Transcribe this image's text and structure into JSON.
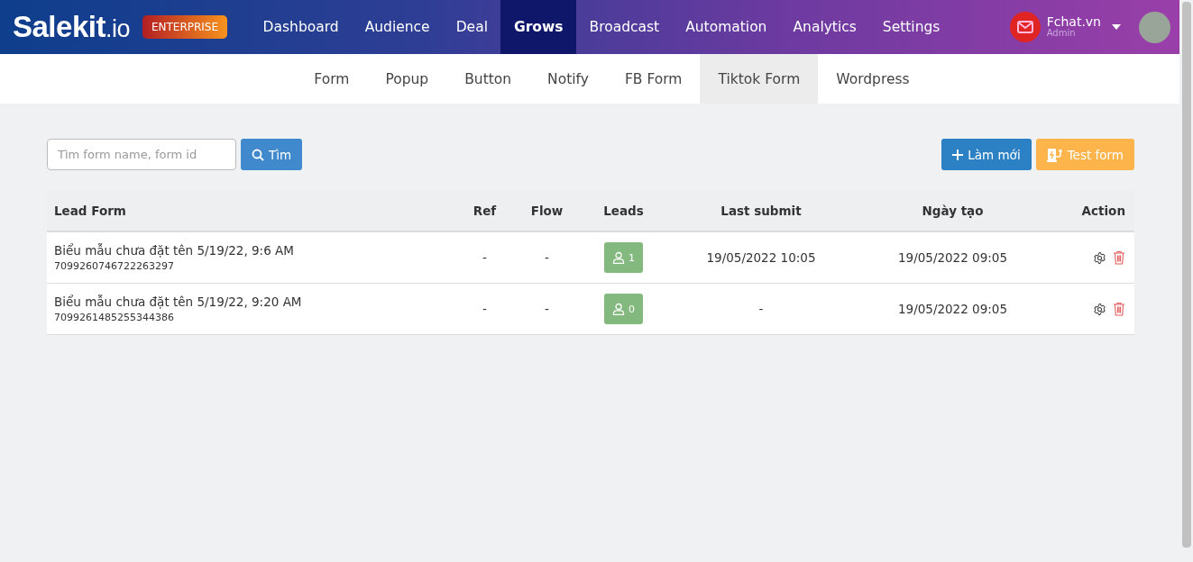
{
  "brand": {
    "name": "Salekit",
    "suffix": ".io",
    "badge": "ENTERPRISE"
  },
  "nav": [
    {
      "label": "Dashboard",
      "selected": false
    },
    {
      "label": "Audience",
      "selected": false
    },
    {
      "label": "Deal",
      "selected": false
    },
    {
      "label": "Grows",
      "selected": true
    },
    {
      "label": "Broadcast",
      "selected": false
    },
    {
      "label": "Automation",
      "selected": false
    },
    {
      "label": "Analytics",
      "selected": false
    },
    {
      "label": "Settings",
      "selected": false
    }
  ],
  "account": {
    "name": "Fchat.vn",
    "role": "Admin"
  },
  "subtabs": [
    {
      "label": "Form",
      "selected": false
    },
    {
      "label": "Popup",
      "selected": false
    },
    {
      "label": "Button",
      "selected": false
    },
    {
      "label": "Notify",
      "selected": false
    },
    {
      "label": "FB Form",
      "selected": false
    },
    {
      "label": "Tiktok Form",
      "selected": true
    },
    {
      "label": "Wordpress",
      "selected": false
    }
  ],
  "search": {
    "placeholder": "Tìm form name, form id",
    "button": "Tìm"
  },
  "actions": {
    "new": "Làm mới",
    "test": "Test form"
  },
  "table": {
    "columns": [
      "Lead Form",
      "Ref",
      "Flow",
      "Leads",
      "Last submit",
      "Ngày tạo",
      "Action"
    ],
    "rows": [
      {
        "name": "Biểu mẫu chưa đặt tên 5/19/22, 9:6 AM",
        "id": "7099260746722263297",
        "ref": "-",
        "flow": "-",
        "leads": "1",
        "last_submit": "19/05/2022 10:05",
        "created": "19/05/2022 09:05"
      },
      {
        "name": "Biểu mẫu chưa đặt tên 5/19/22, 9:20 AM",
        "id": "7099261485255344386",
        "ref": "-",
        "flow": "-",
        "leads": "0",
        "last_submit": "-",
        "created": "19/05/2022 09:05"
      }
    ]
  }
}
